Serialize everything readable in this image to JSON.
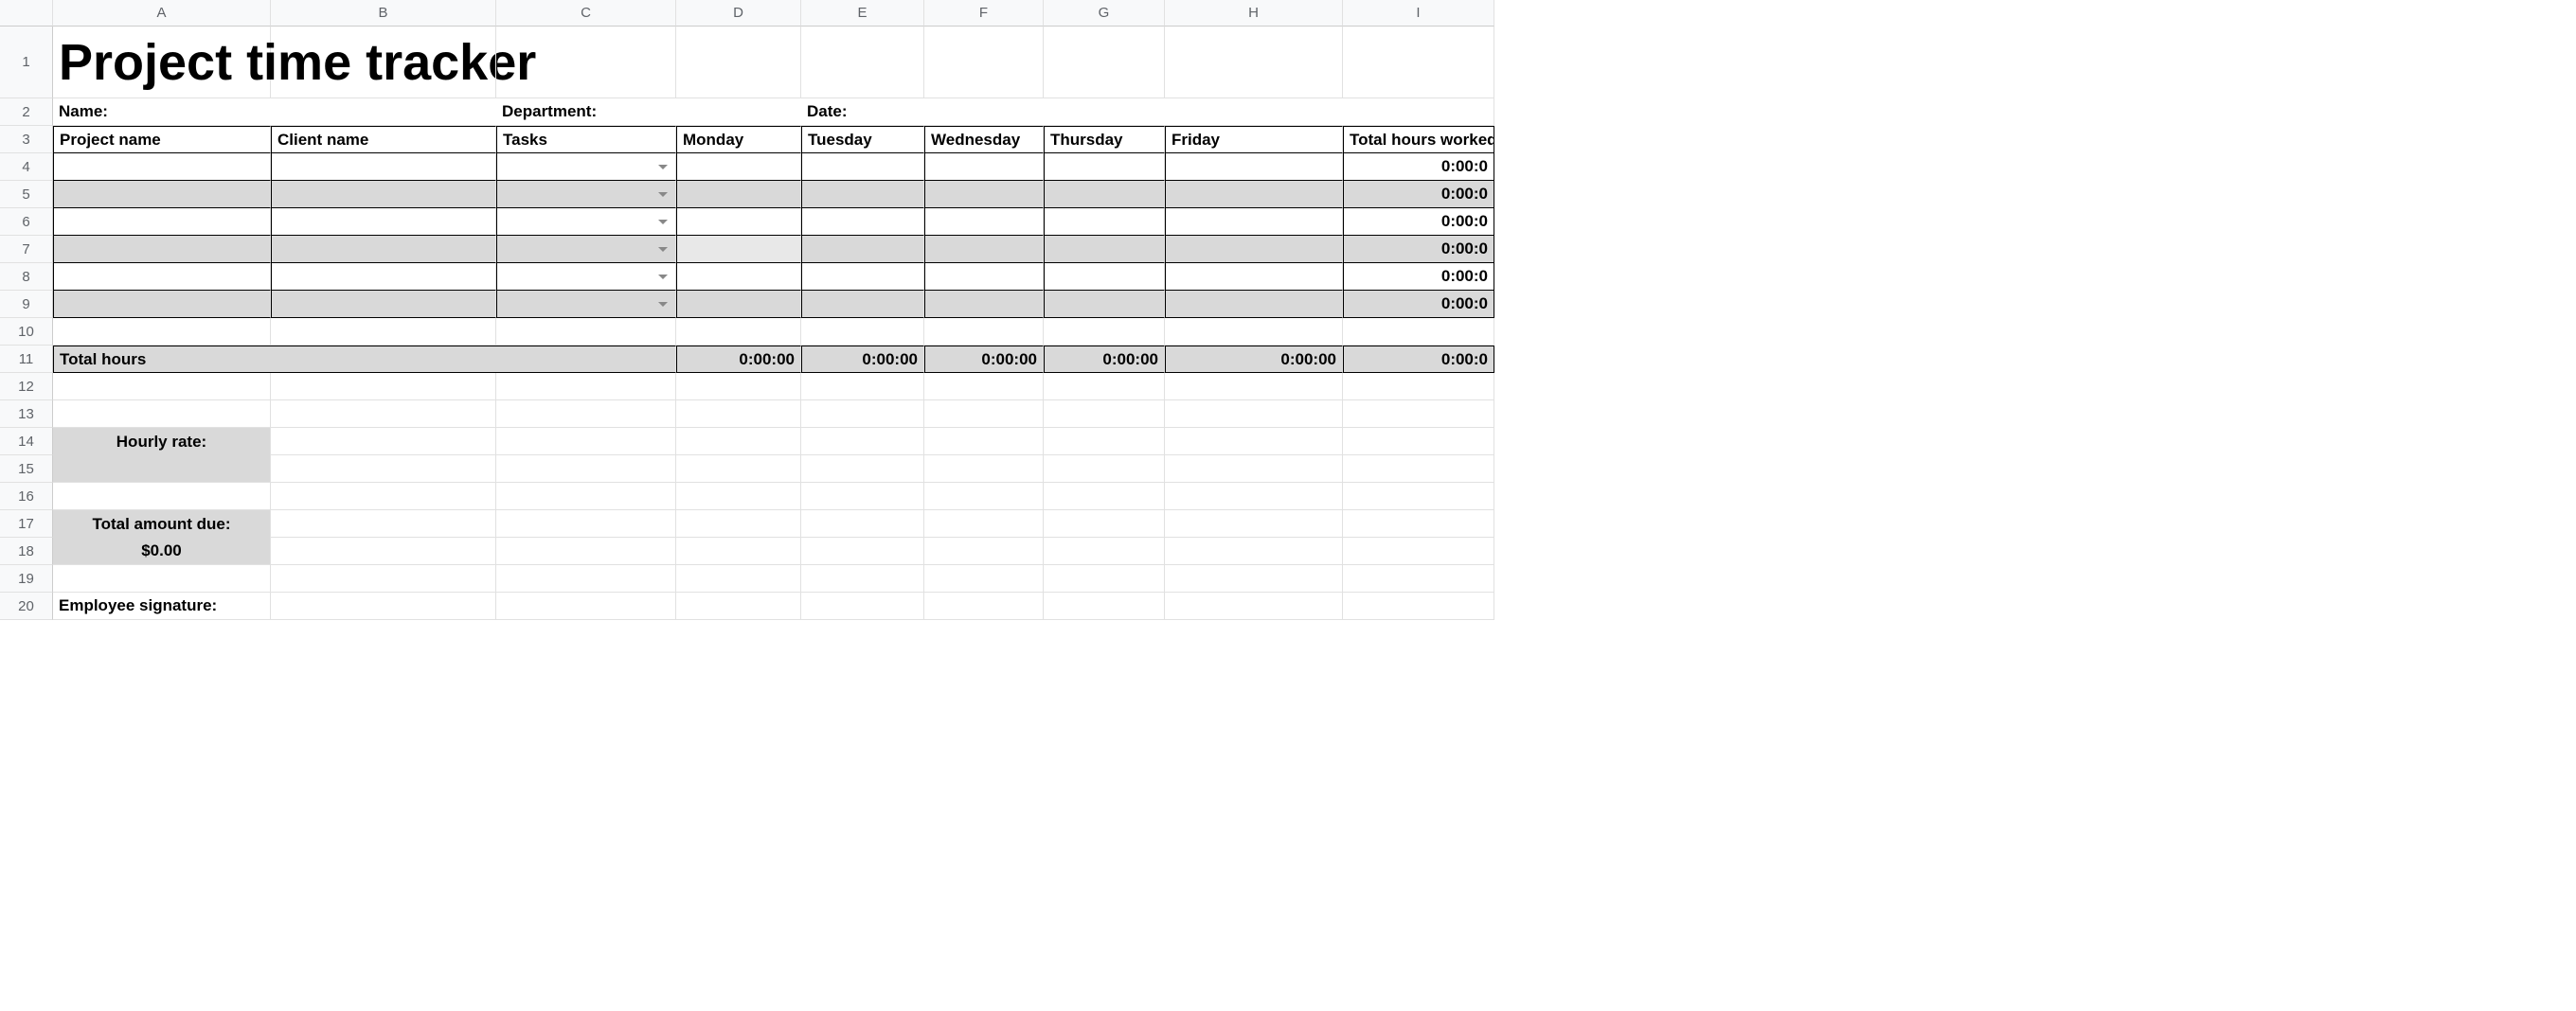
{
  "columns": [
    "A",
    "B",
    "C",
    "D",
    "E",
    "F",
    "G",
    "H",
    "I"
  ],
  "title": "Project time tracker",
  "labels": {
    "name": "Name:",
    "department": "Department:",
    "date": "Date:"
  },
  "headers": {
    "project": "Project name",
    "client": "Client name",
    "tasks": " Tasks",
    "mon": "Monday",
    "tue": "Tuesday",
    "wed": "Wednesday",
    "thu": "Thursday",
    "fri": "Friday",
    "total": "Total hours worked"
  },
  "rows": [
    {
      "total": "0:00:0"
    },
    {
      "total": "0:00:0"
    },
    {
      "total": "0:00:0"
    },
    {
      "total": "0:00:0"
    },
    {
      "total": "0:00:0"
    },
    {
      "total": "0:00:0"
    }
  ],
  "totals": {
    "label": "Total hours",
    "mon": "0:00:00",
    "tue": "0:00:00",
    "wed": "0:00:00",
    "thu": "0:00:00",
    "fri": "0:00:00",
    "total": "0:00:0"
  },
  "hourly_rate_label": "Hourly rate:",
  "total_due_label": "Total amount due:",
  "total_due_value": "$0.00",
  "signature_label": "Employee signature:"
}
